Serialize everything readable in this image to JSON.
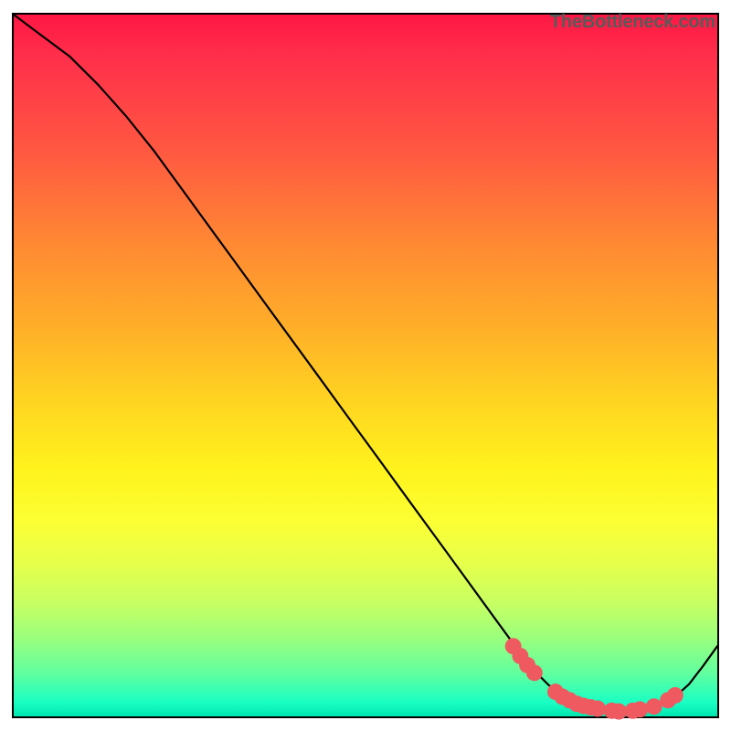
{
  "watermark": "TheBottleneck.com",
  "colors": {
    "border": "#000000",
    "curve": "#000000",
    "dot": "#ef5960",
    "gradient_top": "#ff1744",
    "gradient_bottom": "#00e6b0"
  },
  "chart_data": {
    "type": "line",
    "title": "",
    "xlabel": "",
    "ylabel": "",
    "xlim": [
      0,
      100
    ],
    "ylim": [
      0,
      100
    ],
    "series": [
      {
        "name": "bottleneck-curve",
        "x": [
          0,
          4,
          8,
          12,
          16,
          20,
          24,
          28,
          32,
          36,
          40,
          44,
          48,
          52,
          56,
          60,
          64,
          68,
          72,
          74,
          76,
          78,
          80,
          82,
          84,
          86,
          88,
          90,
          92,
          94,
          96,
          98,
          100
        ],
        "y": [
          100,
          97,
          94,
          90,
          85.5,
          80.5,
          75,
          69.5,
          64,
          58.5,
          53,
          47.5,
          42,
          36.5,
          31,
          25.5,
          20,
          14.5,
          9,
          6.5,
          4.5,
          3,
          2,
          1.3,
          0.9,
          0.7,
          0.7,
          1.0,
          1.6,
          2.8,
          4.6,
          7.2,
          10
        ]
      }
    ],
    "scatter": {
      "name": "dots",
      "points": [
        {
          "x": 71,
          "y": 10.0
        },
        {
          "x": 72,
          "y": 8.6
        },
        {
          "x": 73,
          "y": 7.3
        },
        {
          "x": 74,
          "y": 6.2
        },
        {
          "x": 77,
          "y": 3.5
        },
        {
          "x": 78,
          "y": 2.8
        },
        {
          "x": 79,
          "y": 2.3
        },
        {
          "x": 80,
          "y": 1.8
        },
        {
          "x": 81,
          "y": 1.5
        },
        {
          "x": 82,
          "y": 1.3
        },
        {
          "x": 83,
          "y": 1.1
        },
        {
          "x": 85,
          "y": 0.8
        },
        {
          "x": 86,
          "y": 0.7
        },
        {
          "x": 88,
          "y": 0.8
        },
        {
          "x": 89,
          "y": 1.0
        },
        {
          "x": 91,
          "y": 1.4
        },
        {
          "x": 93,
          "y": 2.3
        },
        {
          "x": 94,
          "y": 3.0
        }
      ]
    }
  }
}
